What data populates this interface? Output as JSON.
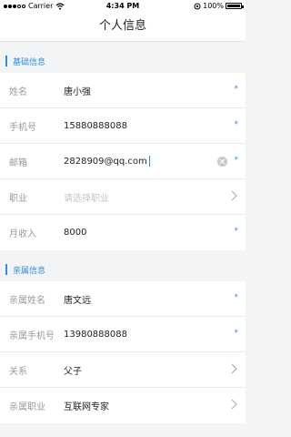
{
  "status_bar": {
    "carrier": "Carrier",
    "time": "4:34 PM",
    "battery": "100%"
  },
  "navbar": {
    "title": "个人信息"
  },
  "basic": {
    "header": "基础信息",
    "rows": [
      {
        "label": "姓名",
        "value": "唐小强",
        "required": "*"
      },
      {
        "label": "手机号",
        "value": "15880888088",
        "required": "*"
      },
      {
        "label": "邮箱",
        "value": "2828909@qq.com",
        "required": "*"
      },
      {
        "label": "职业",
        "placeholder": "请选择职业"
      },
      {
        "label": "月收入",
        "value": "8000",
        "required": "*"
      }
    ]
  },
  "family": {
    "header": "亲属信息",
    "rows": [
      {
        "label": "亲属姓名",
        "value": "唐文远",
        "required": "*"
      },
      {
        "label": "亲属手机号",
        "value": "13980888088",
        "required": "*"
      },
      {
        "label": "关系",
        "value": "父子"
      },
      {
        "label": "亲属职业",
        "value": "互联网专家"
      }
    ]
  }
}
